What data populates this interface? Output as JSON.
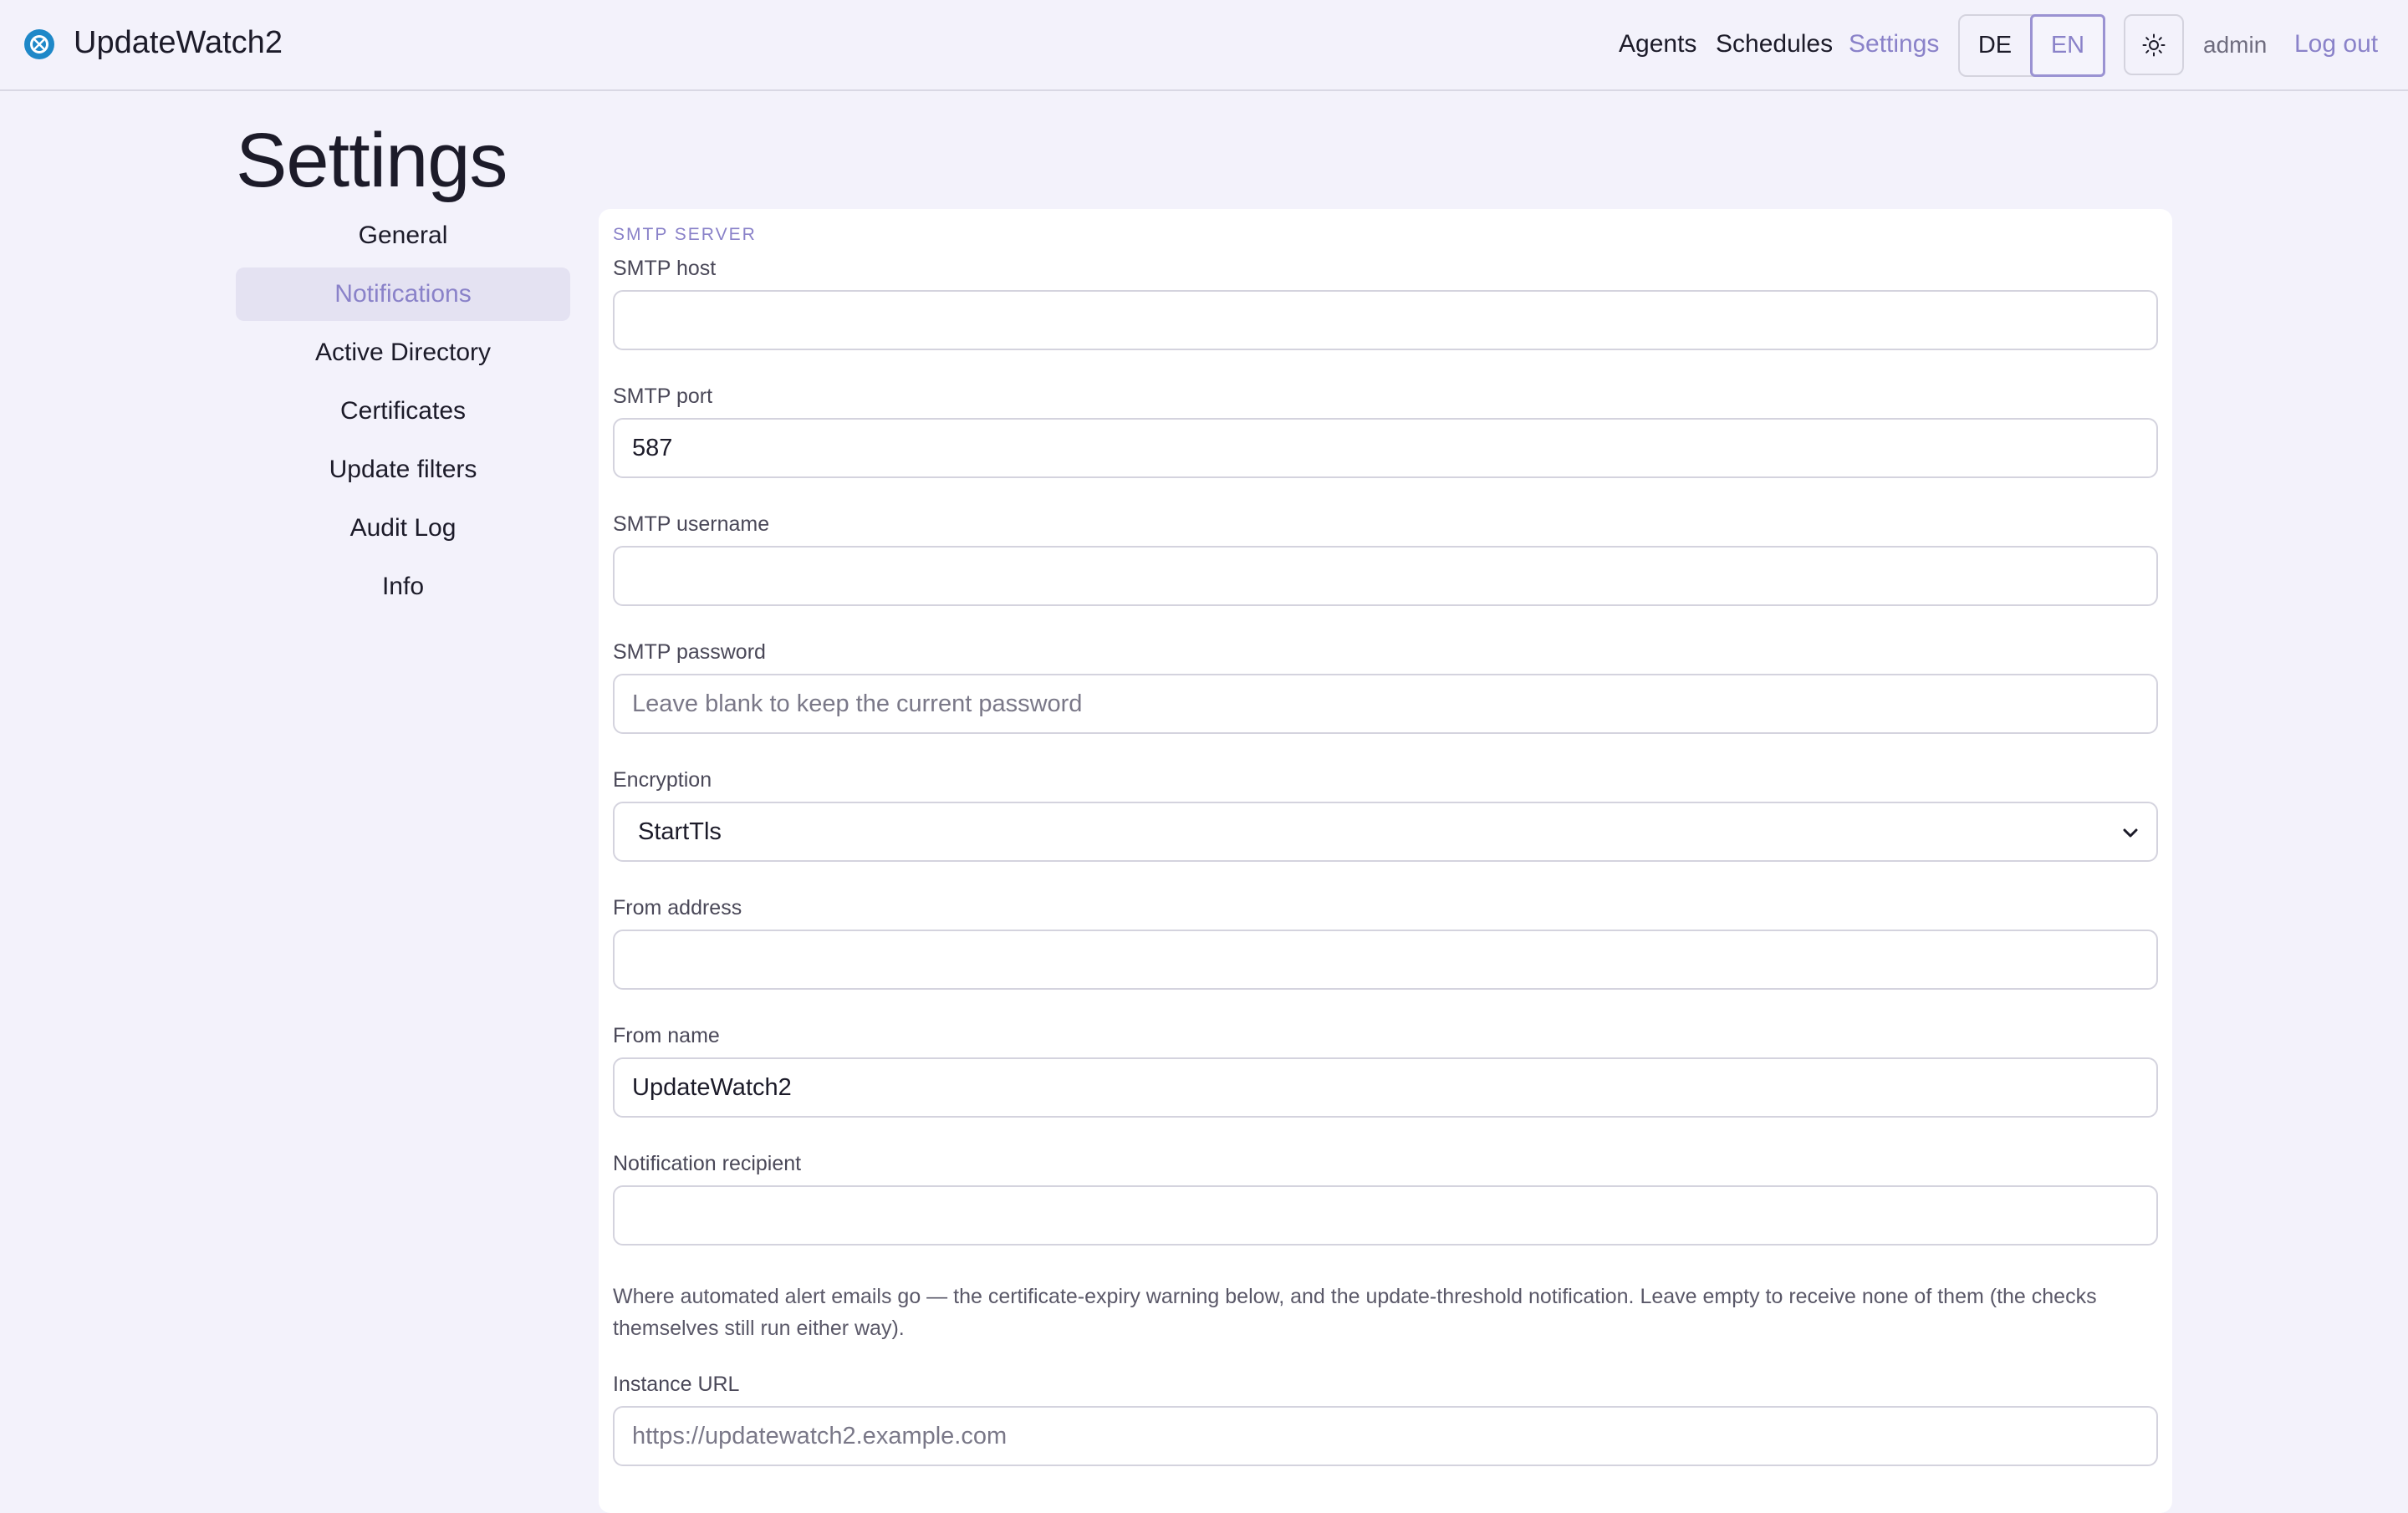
{
  "header": {
    "app_title": "UpdateWatch2",
    "nav": [
      {
        "label": "Agents"
      },
      {
        "label": "Schedules"
      },
      {
        "label": "Settings",
        "active": true
      }
    ],
    "languages": [
      {
        "label": "DE"
      },
      {
        "label": "EN",
        "active": true
      }
    ],
    "user": "admin",
    "logout": "Log out"
  },
  "page": {
    "title": "Settings"
  },
  "sidebar": {
    "items": [
      {
        "label": "General"
      },
      {
        "label": "Notifications",
        "active": true
      },
      {
        "label": "Active Directory"
      },
      {
        "label": "Certificates"
      },
      {
        "label": "Update filters"
      },
      {
        "label": "Audit Log"
      },
      {
        "label": "Info"
      }
    ]
  },
  "smtp": {
    "section_label": "SMTP SERVER",
    "host": {
      "label": "SMTP host",
      "value": ""
    },
    "port": {
      "label": "SMTP port",
      "value": "587"
    },
    "username": {
      "label": "SMTP username",
      "value": ""
    },
    "password": {
      "label": "SMTP password",
      "value": "",
      "placeholder": "Leave blank to keep the current password"
    },
    "encryption": {
      "label": "Encryption",
      "value": "StartTls"
    },
    "from_address": {
      "label": "From address",
      "value": ""
    },
    "from_name": {
      "label": "From name",
      "value": "UpdateWatch2"
    },
    "recipient": {
      "label": "Notification recipient",
      "value": ""
    },
    "recipient_help": "Where automated alert emails go — the certificate-expiry warning below, and the update-threshold notification. Leave empty to receive none of them (the checks themselves still run either way).",
    "instance_url": {
      "label": "Instance URL",
      "value": "",
      "placeholder": "https://updatewatch2.example.com"
    }
  },
  "colors": {
    "accent": "#8a82c9",
    "background": "#f3f2fb",
    "card": "#ffffff",
    "border": "#d4d3de",
    "logo_blue": "#1e88c8"
  },
  "icons": {
    "logo": "updatewatch-logo-icon",
    "theme": "sun-icon",
    "select": "chevron-down-icon"
  }
}
